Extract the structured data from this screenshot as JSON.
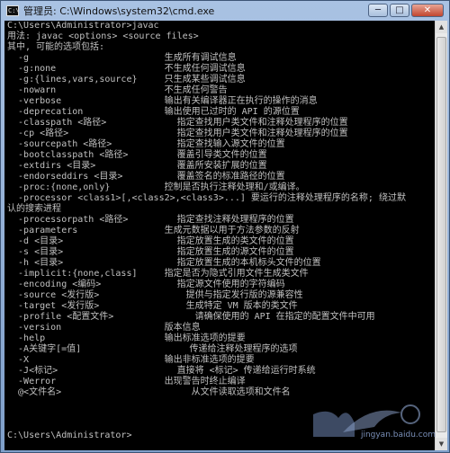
{
  "window": {
    "title": "管理员: C:\\Windows\\system32\\cmd.exe"
  },
  "icons": {
    "app": "cmd-icon",
    "minimize": "minimize-icon",
    "maximize": "maximize-icon",
    "close": "close-icon"
  },
  "controls": {
    "minimize": "─",
    "maximize": "□",
    "close": "✕"
  },
  "scrollbar": {
    "up": "▲",
    "down": "▼"
  },
  "console": {
    "lines": [
      "C:\\Users\\Administrator>javac",
      "用法: javac <options> <source files>",
      "其中, 可能的选项包括:",
      "  -g                         生成所有调试信息",
      "  -g:none                    不生成任何调试信息",
      "  -g:{lines,vars,source}     只生成某些调试信息",
      "  -nowarn                    不生成任何警告",
      "  -verbose                   输出有关编译器正在执行的操作的消息",
      "  -deprecation               输出使用已过时的 API 的源位置",
      "  -classpath <路径>             指定查找用户类文件和注释处理程序的位置",
      "  -cp <路径>                    指定查找用户类文件和注释处理程序的位置",
      "  -sourcepath <路径>            指定查找输入源文件的位置",
      "  -bootclasspath <路径>         覆盖引导类文件的位置",
      "  -extdirs <目录>               覆盖所安装扩展的位置",
      "  -endorseddirs <目录>          覆盖签名的标准路径的位置",
      "  -proc:{none,only}          控制是否执行注释处理和/或编译。",
      "  -processor <class1>[,<class2>,<class3>...] 要运行的注释处理程序的名称; 绕过默",
      "认的搜索进程",
      "  -processorpath <路径>         指定查找注释处理程序的位置",
      "  -parameters                生成元数据以用于方法参数的反射",
      "  -d <目录>                     指定放置生成的类文件的位置",
      "  -s <目录>                     指定放置生成的源文件的位置",
      "  -h <目录>                     指定放置生成的本机标头文件的位置",
      "  -implicit:{none,class]     指定是否为隐式引用文件生成类文件",
      "  -encoding <编码>              指定源文件使用的字符编码",
      "  -source <发行版>                提供与指定发行版的源兼容性",
      "  -target <发行版>                生成特定 VM 版本的类文件",
      "  -profile <配置文件>               请确保使用的 API 在指定的配置文件中可用",
      "  -version                   版本信息",
      "  -help                      输出标准选项的提要",
      "  -A关键字[=值]                    传递给注释处理程序的选项",
      "  -X                         输出非标准选项的提要",
      "  -J<标记>                      直接将 <标记> 传递给运行时系统",
      "  -Werror                    出现警告时终止编译",
      "  @<文件名>                        从文件读取选项和文件名",
      "",
      "",
      "",
      "C:\\Users\\Administrator>"
    ]
  },
  "watermark": {
    "text": "jingyan.baidu.com"
  }
}
